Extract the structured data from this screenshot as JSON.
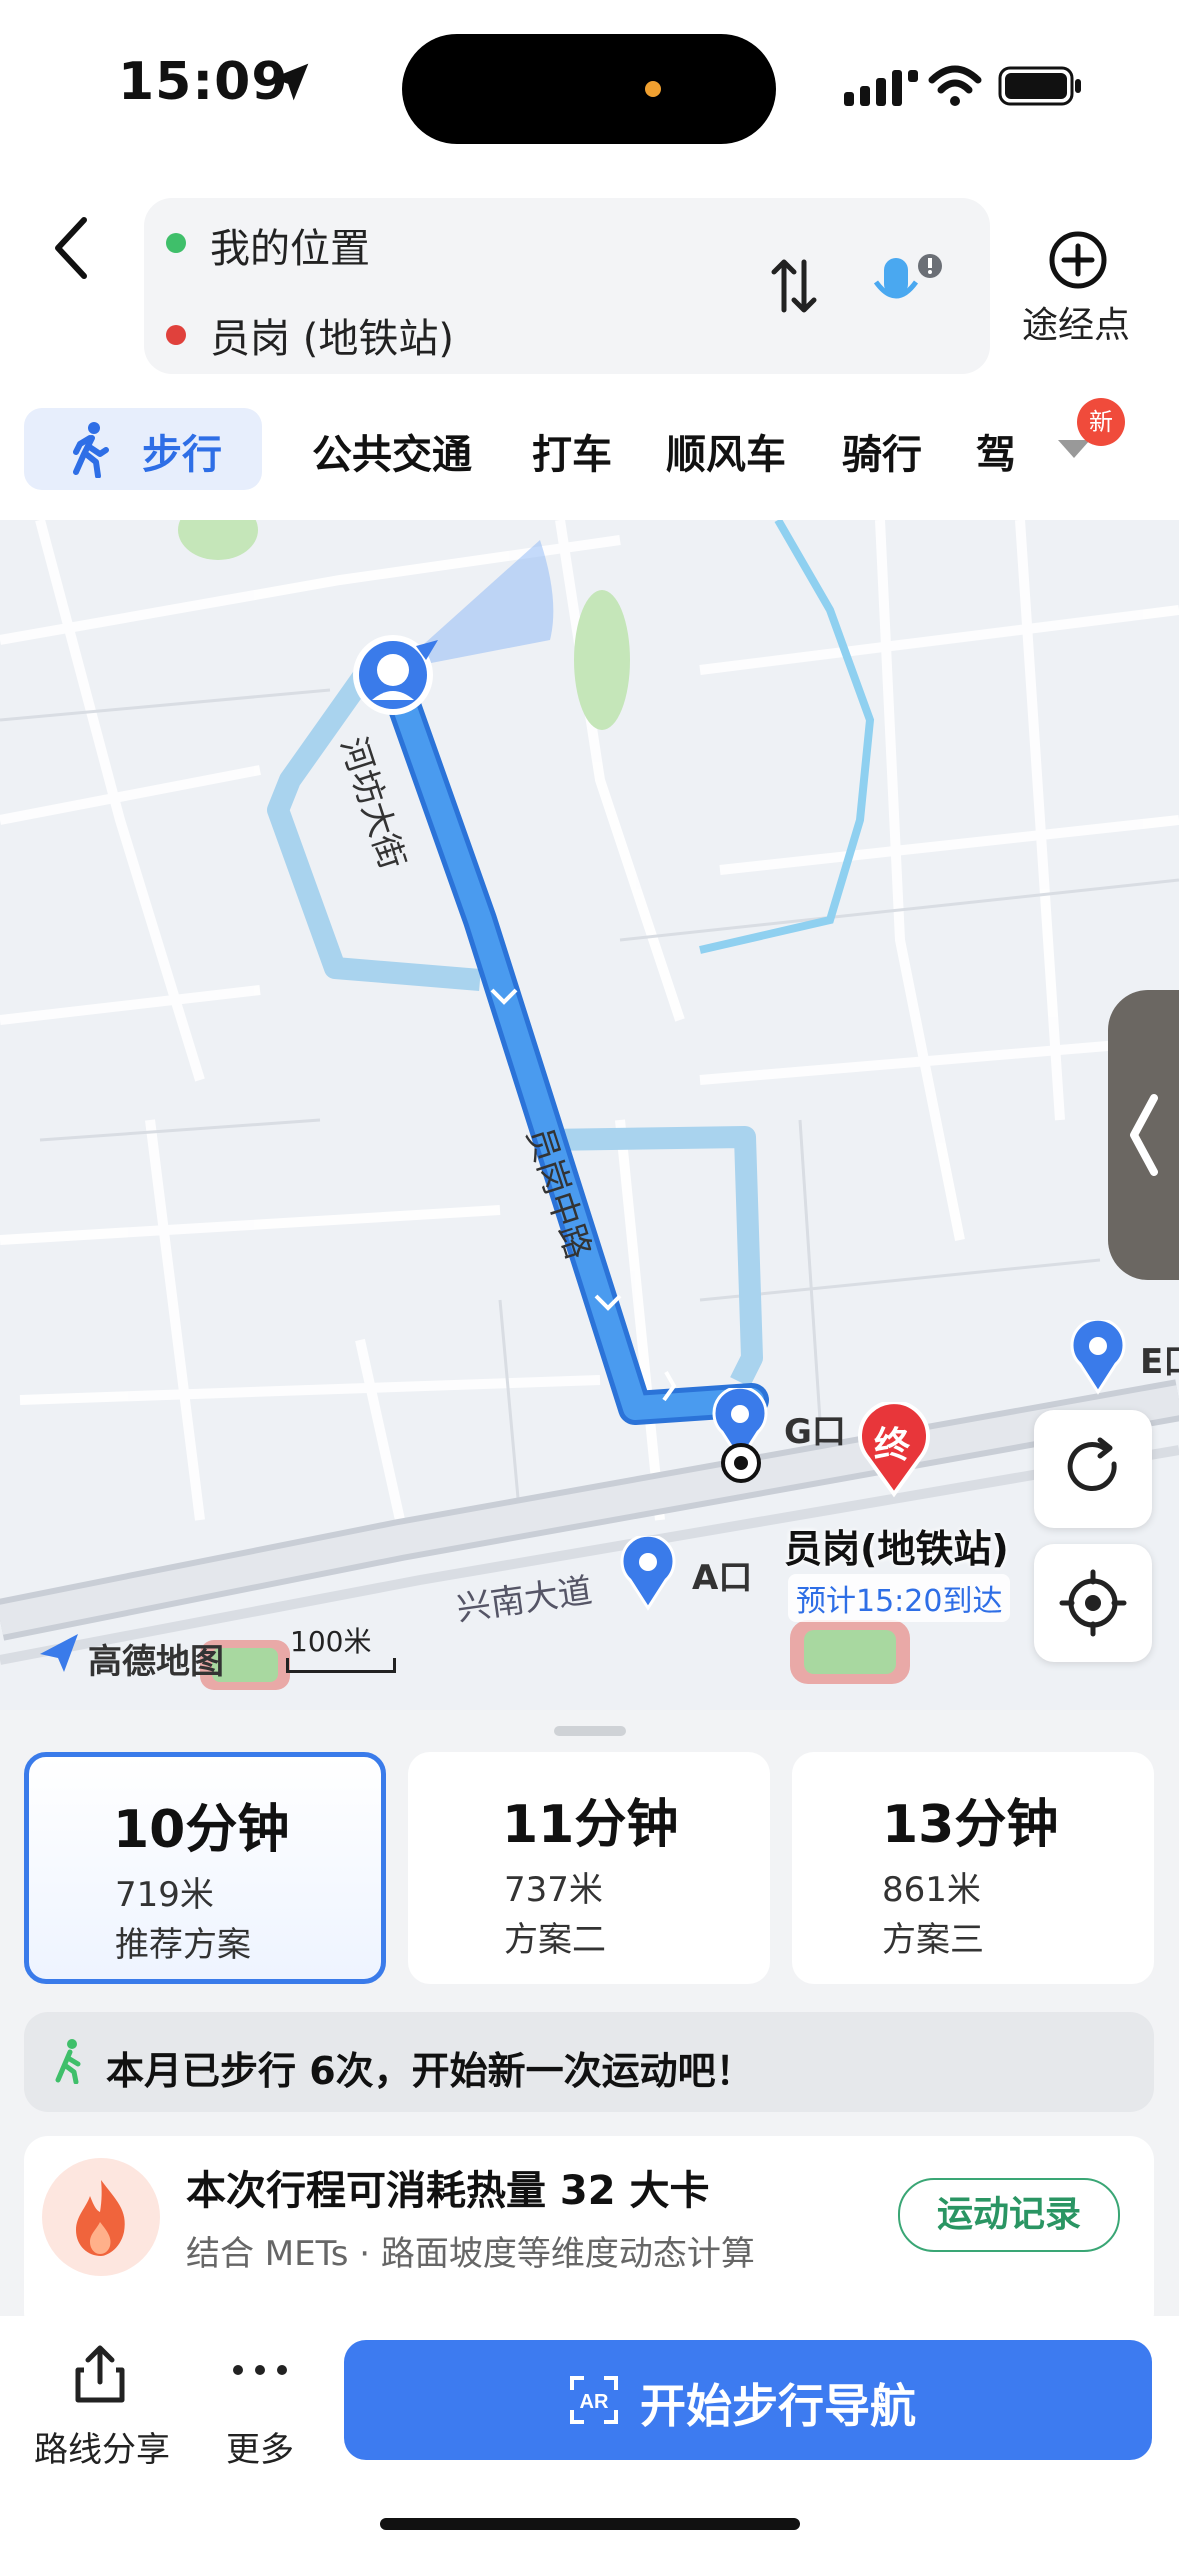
{
  "status_bar": {
    "time": "15:09"
  },
  "header": {
    "origin": "我的位置",
    "destination": "员岗 (地铁站)",
    "waypoint_label": "途经点"
  },
  "modes": {
    "active": "步行",
    "others": [
      "公共交通",
      "打车",
      "顺风车",
      "骑行",
      "驾"
    ],
    "badge": "新"
  },
  "map": {
    "street_1": "河坊大街",
    "street_2": "员岗中路",
    "street_3": "兴南大道",
    "exit_a": "A口",
    "exit_g": "G口",
    "exit_e": "E口",
    "end_marker": "终",
    "destination_name": "员岗(地铁站)",
    "eta": "预计15:20到达",
    "logo_text": "高德地图",
    "scale": "100米"
  },
  "routes": [
    {
      "time": "10分钟",
      "distance": "719米",
      "name": "推荐方案",
      "selected": true
    },
    {
      "time": "11分钟",
      "distance": "737米",
      "name": "方案二",
      "selected": false
    },
    {
      "time": "13分钟",
      "distance": "861米",
      "name": "方案三",
      "selected": false
    }
  ],
  "walk_stats": "本月已步行 6次，开始新一次运动吧！",
  "calories": {
    "title": "本次行程可消耗热量 32 大卡",
    "subtitle": "结合 METs · 路面坡度等维度动态计算",
    "record_button": "运动记录"
  },
  "bottom": {
    "share": "路线分享",
    "more": "更多",
    "start": "开始步行导航"
  },
  "colors": {
    "accent": "#3d7bf0",
    "route": "#4a9bef",
    "alt_route": "#a9d3ee",
    "destination_pin": "#e8363a",
    "green": "#2a9563"
  }
}
